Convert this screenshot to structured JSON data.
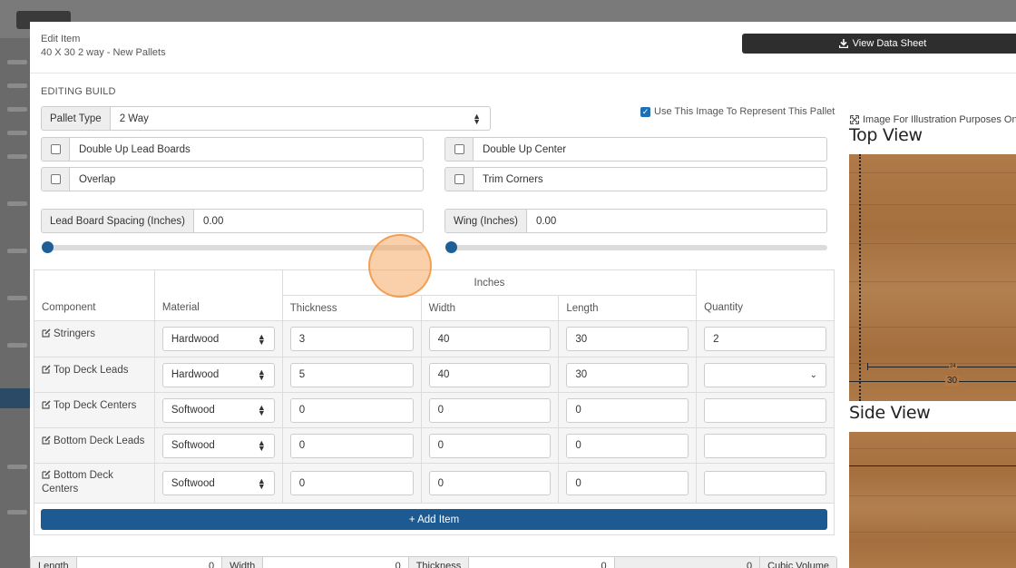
{
  "header": {
    "label": "Edit Item",
    "item_name": "40 X 30 2 way - New Pallets",
    "datasheet_button": "View Data Sheet"
  },
  "build": {
    "section_title": "EDITING BUILD",
    "pallet_type_label": "Pallet Type",
    "pallet_type_value": "2 Way",
    "use_image_label": "Use This Image To Represent This Pallet",
    "use_image_checked": true,
    "options": [
      {
        "label": "Double Up Lead Boards",
        "checked": false
      },
      {
        "label": "Double Up Center",
        "checked": false
      },
      {
        "label": "Overlap",
        "checked": false
      },
      {
        "label": "Trim Corners",
        "checked": false
      }
    ],
    "lead_spacing_label": "Lead Board Spacing (Inches)",
    "lead_spacing_value": "0.00",
    "wing_label": "Wing (Inches)",
    "wing_value": "0.00",
    "lead_spacing_slider": 0,
    "wing_slider": 0
  },
  "table": {
    "group_header": "Inches",
    "columns": {
      "component": "Component",
      "material": "Material",
      "thickness": "Thickness",
      "width": "Width",
      "length": "Length",
      "quantity": "Quantity"
    },
    "rows": [
      {
        "component": "Stringers",
        "material": "Hardwood",
        "thickness": "3",
        "width": "40",
        "length": "30",
        "quantity": "2"
      },
      {
        "component": "Top Deck Leads",
        "material": "Hardwood",
        "thickness": "5",
        "width": "40",
        "length": "30",
        "quantity": ""
      },
      {
        "component": "Top Deck Centers",
        "material": "Softwood",
        "thickness": "0",
        "width": "0",
        "length": "0",
        "quantity": ""
      },
      {
        "component": "Bottom Deck Leads",
        "material": "Softwood",
        "thickness": "0",
        "width": "0",
        "length": "0",
        "quantity": ""
      },
      {
        "component": "Bottom Deck Centers",
        "material": "Softwood",
        "thickness": "0",
        "width": "0",
        "length": "0",
        "quantity": ""
      }
    ],
    "add_item_label": "+ Add Item"
  },
  "summary": {
    "length_label": "Length",
    "length_value": "0",
    "width_label": "Width",
    "width_value": "0",
    "thickness_label": "Thickness",
    "thickness_value": "0",
    "extra_value": "0",
    "cubic_label": "Cubic Volume"
  },
  "illustration": {
    "note": "Image For Illustration Purposes Only",
    "top_view": "Top View",
    "side_view": "Side View",
    "dim_24": "24",
    "dim_30": "30"
  },
  "colors": {
    "primary": "#1c5a91",
    "dark_button": "#2e2e2e",
    "wood": "#b07a48",
    "click_marker": "#f5aa64"
  }
}
